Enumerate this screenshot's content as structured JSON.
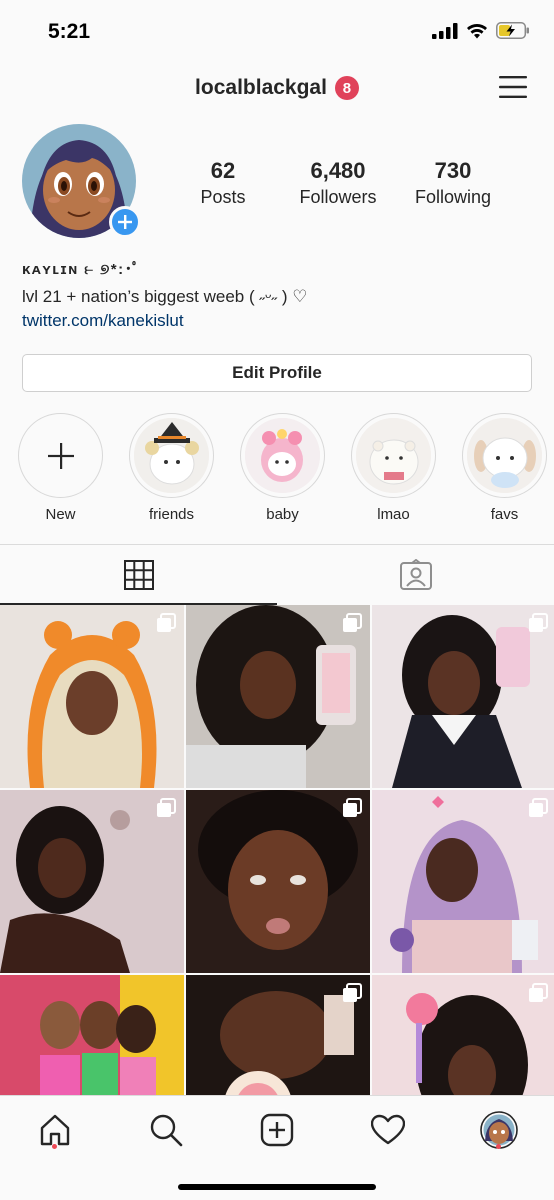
{
  "status_bar": {
    "time": "5:21",
    "icons": [
      "signal-icon",
      "wifi-icon",
      "battery-charging-icon"
    ]
  },
  "header": {
    "username": "localblackgal",
    "notification_count": "8",
    "menu_icon": "hamburger-menu-icon"
  },
  "profile": {
    "stats": [
      {
        "value": "62",
        "label": "Posts"
      },
      {
        "value": "6,480",
        "label": "Followers"
      },
      {
        "value": "730",
        "label": "Following"
      }
    ],
    "display_name": "ᴋᴀʏʟɪɴ ⥼ ୭*:･ﾟ",
    "bio": "lvl 21 + nation’s biggest weeb ( ˶ᵕ˶ ) ♡",
    "link": "twitter.com/kanekislut",
    "edit_button": "Edit Profile"
  },
  "highlights": [
    {
      "label": "New",
      "icon": "plus-icon"
    },
    {
      "label": "friends"
    },
    {
      "label": "baby"
    },
    {
      "label": "lmao"
    },
    {
      "label": "favs"
    }
  ],
  "tabs": [
    {
      "icon": "grid-icon",
      "active": true
    },
    {
      "icon": "tagged-icon",
      "active": false
    }
  ],
  "colors": {
    "accent_blue": "#3897f0",
    "badge_red": "#e0425a",
    "link_blue": "#003569",
    "text": "#262626"
  },
  "bottom_nav": [
    "home-icon",
    "search-icon",
    "new-post-icon",
    "activity-heart-icon",
    "profile-avatar"
  ]
}
